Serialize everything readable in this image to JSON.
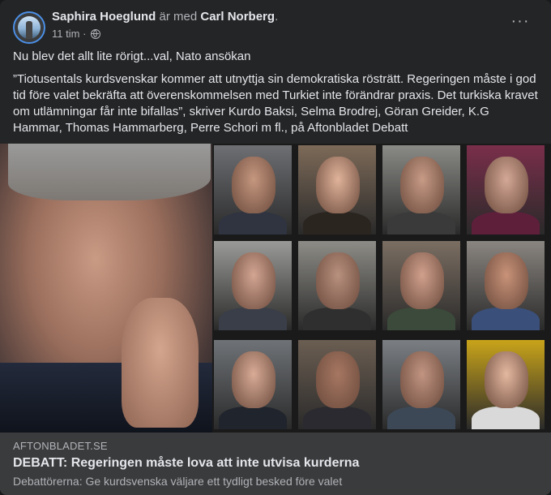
{
  "post": {
    "author": "Saphira Hoeglund",
    "with_text": "är med",
    "tagged": "Carl Norberg",
    "tagged_suffix": ".",
    "time": "11 tim",
    "dot": "·",
    "more_label": "···",
    "line1": "Nu blev det allt lite rörigt...val, Nato ansökan",
    "body": "”Tiotusentals kurdsvenskar kommer att utnyttja sin demokratiska rösträtt. Regeringen måste i god tid före valet bekräfta att överenskommelsen med Turkiet inte förändrar praxis. Det turkiska kravet om utlämningar får inte bifallas”, skriver Kurdo Baksi, Selma Brodrej, Göran Greider, K.G Hammar, Thomas Hammarberg, Perre Schori m fl., på Aftonbladet Debatt"
  },
  "link": {
    "domain": "AFTONBLADET.SE",
    "headline": "DEBATT: Regeringen måste lova att inte utvisa kurderna",
    "description": "Debattörerna: Ge kurdsvenska väljare ett tydligt besked före valet"
  },
  "icons": {
    "privacy": "globe-icon",
    "menu": "more-options-icon"
  },
  "colors": {
    "card_bg": "#242526",
    "link_bg": "#3a3b3c",
    "primary_text": "#e4e6eb",
    "secondary_text": "#b0b3b8"
  }
}
